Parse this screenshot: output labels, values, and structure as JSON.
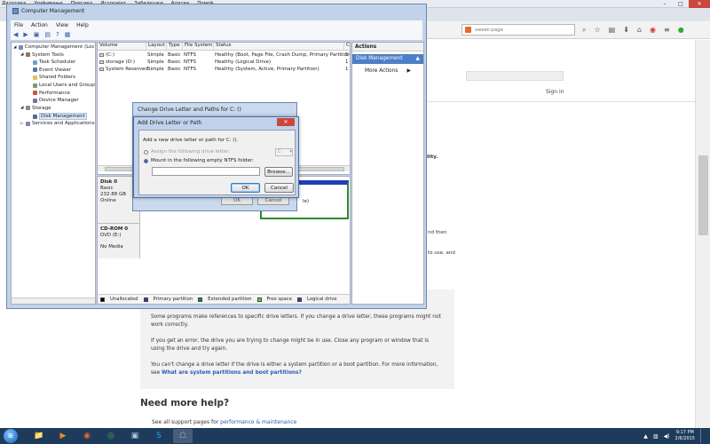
{
  "browser": {
    "menu": [
      "Датотека",
      "Уређивање",
      "Преглед",
      "Историјат",
      "Забелешки",
      "Алатке",
      "Помоћ"
    ],
    "url_text": "sweet-page",
    "caption_min": "–",
    "caption_max": "□",
    "caption_close": "✕"
  },
  "webpage": {
    "sign_in": "Sign in",
    "snip_ility": "ility.",
    "snip_nd_then": "nd then",
    "snip_to_use": "to use, and",
    "note_p1": "Some programs make references to specific drive letters. If you change a drive letter, these programs might not work correctly.",
    "note_p2": "If you get an error, the drive you are trying to change might be in use. Close any program or window that is using the drive and try again.",
    "note_p3_text": "You can't change a drive letter if the drive is either a system partition or a boot partition. For more information, see ",
    "note_p3_link": "What are system partitions and boot partitions?",
    "need_help": "Need more help?",
    "see_all_text": "See all support pages for ",
    "see_all_link": "performance & maintenance"
  },
  "cm": {
    "title": "Computer Management",
    "menu": [
      "File",
      "Action",
      "View",
      "Help"
    ],
    "tree": [
      {
        "label": "Computer Management (Local",
        "indent": 0,
        "icon": "computer-icon",
        "color": "#6d8fb8"
      },
      {
        "label": "System Tools",
        "indent": 1,
        "icon": "tools-icon",
        "color": "#8a7a5a"
      },
      {
        "label": "Task Scheduler",
        "indent": 2,
        "icon": "clock-icon",
        "color": "#7a9cc8"
      },
      {
        "label": "Event Viewer",
        "indent": 2,
        "icon": "event-icon",
        "color": "#5a7a9a"
      },
      {
        "label": "Shared Folders",
        "indent": 2,
        "icon": "folder-icon",
        "color": "#e3c35a"
      },
      {
        "label": "Local Users and Groups",
        "indent": 2,
        "icon": "users-icon",
        "color": "#7a9a6a"
      },
      {
        "label": "Performance",
        "indent": 2,
        "icon": "performance-icon",
        "color": "#c85a3a"
      },
      {
        "label": "Device Manager",
        "indent": 2,
        "icon": "device-icon",
        "color": "#6a7a9a"
      },
      {
        "label": "Storage",
        "indent": 1,
        "icon": "storage-icon",
        "color": "#8a8a8a"
      },
      {
        "label": "Disk Management",
        "indent": 2,
        "icon": "disk-icon",
        "color": "#5a6a8a",
        "selected": true
      },
      {
        "label": "Services and Applications",
        "indent": 1,
        "icon": "services-icon",
        "color": "#7a8aa8"
      }
    ],
    "columns": [
      "Volume",
      "Layout",
      "Type",
      "File System",
      "Status",
      "C"
    ],
    "volumes": [
      {
        "volume": "(C:)",
        "layout": "Simple",
        "type": "Basic",
        "fs": "NTFS",
        "status": "Healthy (Boot, Page File, Crash Dump, Primary Partition)",
        "c": "5"
      },
      {
        "volume": "storage (D:)",
        "layout": "Simple",
        "type": "Basic",
        "fs": "NTFS",
        "status": "Healthy (Logical Drive)",
        "c": "1"
      },
      {
        "volume": "System Reserved",
        "layout": "Simple",
        "type": "Basic",
        "fs": "NTFS",
        "status": "Healthy (System, Active, Primary Partition)",
        "c": "1"
      }
    ],
    "disk0": {
      "name": "Disk 0",
      "type": "Basic",
      "size": "232.88 GB",
      "state": "Online"
    },
    "cdrom": {
      "name": "CD-ROM 0",
      "drive": "DVD (E:)",
      "state": "No Media"
    },
    "partial_label": "le)",
    "legend": [
      {
        "label": "Unallocated",
        "color": "#000000"
      },
      {
        "label": "Primary partition",
        "color": "#1f3fb6"
      },
      {
        "label": "Extended partition",
        "color": "#2a8a2a"
      },
      {
        "label": "Free space",
        "color": "#44dd44"
      },
      {
        "label": "Logical drive",
        "color": "#2244cc"
      }
    ],
    "actions": {
      "header": "Actions",
      "selected": "Disk Management",
      "more": "More Actions"
    }
  },
  "dialog_change": {
    "title": "Change Drive Letter and Paths for C: ()",
    "ok": "OK",
    "cancel": "Cancel"
  },
  "dialog_add": {
    "title": "Add Drive Letter or Path",
    "close": "✕",
    "instruction": "Add a new drive letter or path for C: ().",
    "option_letter": "Assign the following drive letter:",
    "drive_letter": "C",
    "option_folder": "Mount in the following empty NTFS folder:",
    "folder_value": "",
    "browse": "Browse...",
    "ok": "OK",
    "cancel": "Cancel"
  },
  "taskbar": {
    "time": "9:17 PM",
    "date": "2/6/2015",
    "apps": [
      {
        "name": "explorer-taskbar-icon",
        "glyph": "📁",
        "color": "#e8c15a"
      },
      {
        "name": "media-taskbar-icon",
        "glyph": "▶",
        "color": "#f08a24"
      },
      {
        "name": "firefox-taskbar-icon",
        "glyph": "◉",
        "color": "#e66a2c"
      },
      {
        "name": "chrome-taskbar-icon",
        "glyph": "◎",
        "color": "#4caf50"
      },
      {
        "name": "screen-taskbar-icon",
        "glyph": "▣",
        "color": "#b0c4de"
      },
      {
        "name": "skype-taskbar-icon",
        "glyph": "S",
        "color": "#26a8e0"
      },
      {
        "name": "computer-management-taskbar-icon",
        "glyph": "☖",
        "color": "#8fb3e3"
      }
    ]
  }
}
